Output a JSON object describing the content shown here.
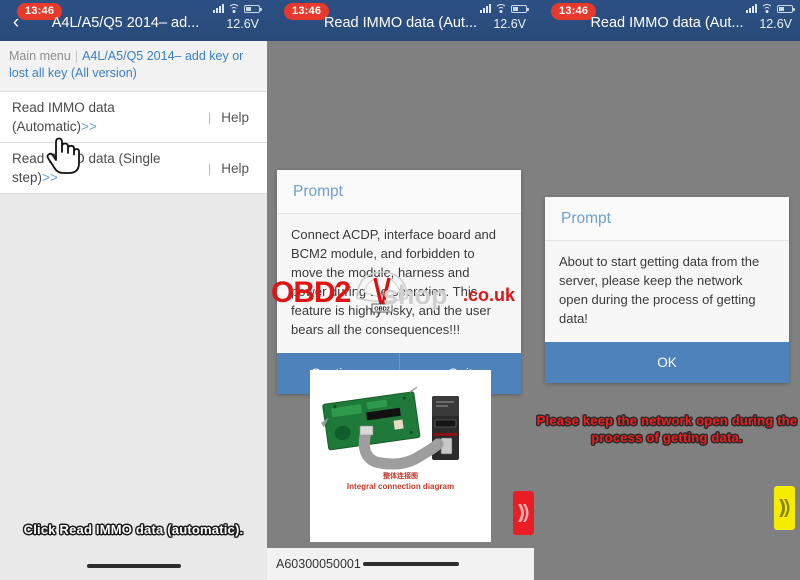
{
  "statusbar": {
    "time": "13:46",
    "voltage": "12.6V",
    "icons": [
      "signal-icon",
      "wifi-icon",
      "battery-icon"
    ]
  },
  "panel1": {
    "nav": {
      "back": "‹",
      "title": "A4L/A5/Q5 2014– ad..."
    },
    "breadcrumb": {
      "root": "Main menu",
      "separator": "|",
      "current": "A4L/A5/Q5 2014– add key or lost all key (All version)"
    },
    "list": [
      {
        "label": "Read IMMO data (Automatic)",
        "chevron": ">>",
        "sep": "|",
        "help": "Help"
      },
      {
        "label": "Read IMMO data (Single step)",
        "chevron": ">>",
        "sep": "|",
        "help": "Help"
      }
    ],
    "caption": "Click Read IMMO data (automatic)."
  },
  "panel2": {
    "nav": {
      "title": "Read IMMO data (Aut..."
    },
    "dialog": {
      "title": "Prompt",
      "body": "Connect ACDP, interface board and BCM2 module, and forbidden to move the module, harness and power during the operation.\nThis feature is highly risky, and the user bears all the consequences!!!",
      "buttons": [
        "Continue",
        "Quit"
      ]
    },
    "image_card": {
      "caption_cn": "整体连接图",
      "caption_en": "Integral connection diagram"
    },
    "bottom": {
      "serial": "A60300050001"
    },
    "side_tab": {
      "name": "next-arrow-red",
      "glyph": "»"
    }
  },
  "panel3": {
    "nav": {
      "title": "Read IMMO data (Aut..."
    },
    "dialog": {
      "title": "Prompt",
      "body": "About to start getting data from the server, please keep the network open during the process of getting data!",
      "buttons": [
        "OK"
      ]
    },
    "caption": "Please keep the network open during the process of getting data.",
    "side_tab": {
      "name": "next-arrow-yellow",
      "glyph": "»"
    }
  },
  "watermark": {
    "brand": "OBD2",
    "shop": "shop",
    "tld": ".co.uk",
    "plate": "OBD2"
  },
  "colors": {
    "navbar": "#2b4f81",
    "accent_blue": "#4d82bb",
    "link_blue": "#3b7fc4",
    "red": "#e8392d",
    "caption_red": "#ef1d1d",
    "yellow": "#f5ec00",
    "panel_bg": "#808080"
  }
}
